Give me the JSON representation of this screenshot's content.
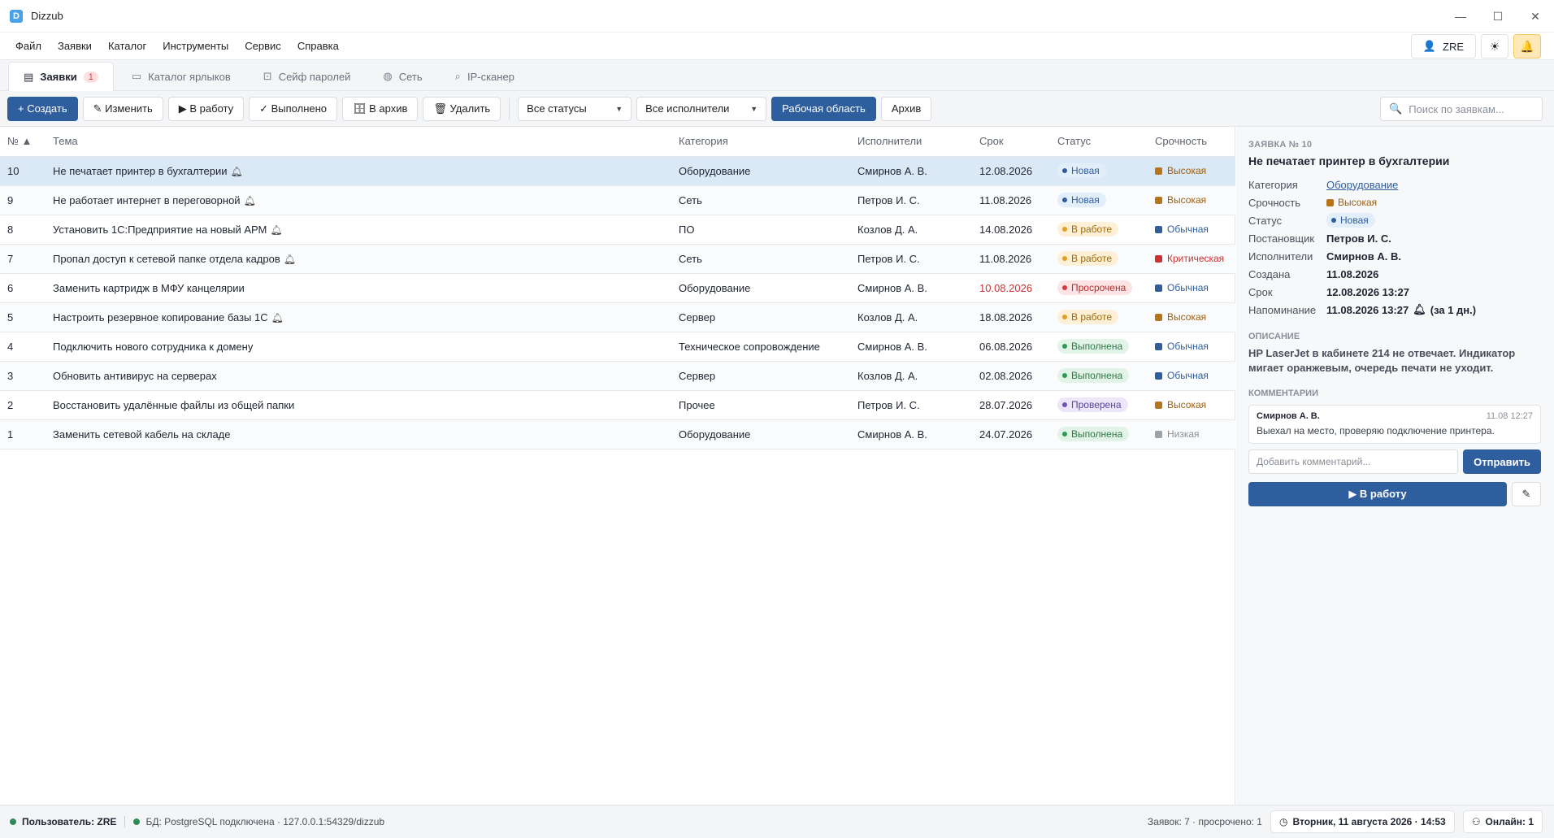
{
  "window": {
    "title": "Dizzub",
    "logo_letter": "D"
  },
  "menubar": {
    "items": [
      "Файл",
      "Заявки",
      "Каталог",
      "Инструменты",
      "Сервис",
      "Справка"
    ],
    "user_label": "ZRE",
    "theme_icon": "sun-icon",
    "notify_icon": "bell-icon"
  },
  "tabs": [
    {
      "label": "Заявки",
      "badge": "1",
      "icon": "clipboard-icon",
      "active": true
    },
    {
      "label": "Каталог ярлыков",
      "icon": "folder-icon",
      "active": false
    },
    {
      "label": "Сейф паролей",
      "icon": "lock-icon",
      "active": false
    },
    {
      "label": "Сеть",
      "icon": "globe-icon",
      "active": false
    },
    {
      "label": "IP-сканер",
      "icon": "magnifier-icon",
      "active": false
    }
  ],
  "toolbar": {
    "create": "+ Создать",
    "edit": "✎ Изменить",
    "to_work": "▶ В работу",
    "done": "✓ Выполнено",
    "archive": "🗄 В архив",
    "delete": "🗑 Удалить",
    "status_filter": "Все статусы",
    "assignee_filter": "Все исполнители",
    "workspace": "Рабочая область",
    "archive_view": "Архив",
    "search_placeholder": "Поиск по заявкам..."
  },
  "table": {
    "headers": [
      "№ ▲",
      "Тема",
      "Категория",
      "Исполнители",
      "Срок",
      "Статус",
      "Срочность"
    ],
    "rows": [
      {
        "num": "10",
        "topic": "Не печатает принтер в бухгалтерии",
        "bell": true,
        "category": "Оборудование",
        "assignee": "Смирнов А. В.",
        "due": "12.08.2026",
        "overdue": false,
        "status": "Новая",
        "status_kind": "new",
        "urgency": "Высокая",
        "urgency_kind": "high"
      },
      {
        "num": "9",
        "topic": "Не работает интернет в переговорной",
        "bell": true,
        "category": "Сеть",
        "assignee": "Петров И. С.",
        "due": "11.08.2026",
        "overdue": false,
        "status": "Новая",
        "status_kind": "new",
        "urgency": "Высокая",
        "urgency_kind": "high"
      },
      {
        "num": "8",
        "topic": "Установить 1С:Предприятие на новый АРМ",
        "bell": true,
        "category": "ПО",
        "assignee": "Козлов Д. А.",
        "due": "14.08.2026",
        "overdue": false,
        "status": "В работе",
        "status_kind": "work",
        "urgency": "Обычная",
        "urgency_kind": "normal"
      },
      {
        "num": "7",
        "topic": "Пропал доступ к сетевой папке отдела кадров",
        "bell": true,
        "category": "Сеть",
        "assignee": "Петров И. С.",
        "due": "11.08.2026",
        "overdue": false,
        "status": "В работе",
        "status_kind": "work",
        "urgency": "Критическая",
        "urgency_kind": "critical"
      },
      {
        "num": "6",
        "topic": "Заменить картридж в МФУ канцелярии",
        "bell": false,
        "category": "Оборудование",
        "assignee": "Смирнов А. В.",
        "due": "10.08.2026",
        "overdue": true,
        "status": "Просрочена",
        "status_kind": "overdue",
        "urgency": "Обычная",
        "urgency_kind": "normal"
      },
      {
        "num": "5",
        "topic": "Настроить резервное копирование базы 1С",
        "bell": true,
        "category": "Сервер",
        "assignee": "Козлов Д. А.",
        "due": "18.08.2026",
        "overdue": false,
        "status": "В работе",
        "status_kind": "work",
        "urgency": "Высокая",
        "urgency_kind": "high"
      },
      {
        "num": "4",
        "topic": "Подключить нового сотрудника к домену",
        "bell": false,
        "category": "Техническое сопровождение",
        "assignee": "Смирнов А. В.",
        "due": "06.08.2026",
        "overdue": false,
        "status": "Выполнена",
        "status_kind": "done",
        "urgency": "Обычная",
        "urgency_kind": "normal"
      },
      {
        "num": "3",
        "topic": "Обновить антивирус на серверах",
        "bell": false,
        "category": "Сервер",
        "assignee": "Козлов Д. А.",
        "due": "02.08.2026",
        "overdue": false,
        "status": "Выполнена",
        "status_kind": "done",
        "urgency": "Обычная",
        "urgency_kind": "normal"
      },
      {
        "num": "2",
        "topic": "Восстановить удалённые файлы из общей папки",
        "bell": false,
        "category": "Прочее",
        "assignee": "Петров И. С.",
        "due": "28.07.2026",
        "overdue": false,
        "status": "Проверена",
        "status_kind": "checked",
        "urgency": "Высокая",
        "urgency_kind": "high"
      },
      {
        "num": "1",
        "topic": "Заменить сетевой кабель на складе",
        "bell": false,
        "category": "Оборудование",
        "assignee": "Смирнов А. В.",
        "due": "24.07.2026",
        "overdue": false,
        "status": "Выполнена",
        "status_kind": "done",
        "urgency": "Низкая",
        "urgency_kind": "low"
      }
    ]
  },
  "status_colors": {
    "new": {
      "bg": "#e3eefb",
      "fg": "#2f5e9e",
      "dot": "#2f5e9e"
    },
    "work": {
      "bg": "#fdf0d6",
      "fg": "#9a6a10",
      "dot": "#e0a020"
    },
    "overdue": {
      "bg": "#fde3e3",
      "fg": "#b33030",
      "dot": "#d63b3b"
    },
    "done": {
      "bg": "#e2f3e7",
      "fg": "#2b7a46",
      "dot": "#2e9a56"
    },
    "checked": {
      "bg": "#ece6f8",
      "fg": "#5a44a0",
      "dot": "#6a52b8"
    }
  },
  "urgency_colors": {
    "high": {
      "sq": "#b8741a",
      "fg": "#9a5e12"
    },
    "normal": {
      "sq": "#2f5e9e",
      "fg": "#2f5e9e"
    },
    "critical": {
      "sq": "#c93333",
      "fg": "#c93333"
    },
    "low": {
      "sq": "#9aa1ab",
      "fg": "#8a9099"
    }
  },
  "selected_row": 0,
  "detail": {
    "kicker": "ЗАЯВКА № 10",
    "title": "Не печатает принтер в бухгалтерии",
    "fields": {
      "category_label": "Категория",
      "category": "Оборудование",
      "urgency_label": "Срочность",
      "urgency": "Высокая",
      "status_label": "Статус",
      "status": "Новая",
      "reporter_label": "Постановщик",
      "reporter": "Петров И. С.",
      "assignees_label": "Исполнители",
      "assignees": "Смирнов А. В.",
      "created_label": "Создана",
      "created": "11.08.2026",
      "due_label": "Срок",
      "due": "12.08.2026 13:27",
      "reminder_label": "Напоминание",
      "reminder": "11.08.2026 13:27",
      "reminder_note": "(за 1 дн.)"
    },
    "description_header": "ОПИСАНИЕ",
    "description": "HP LaserJet в кабинете 214 не отвечает. Индикатор мигает оранжевым, очередь печати не уходит.",
    "comments_header": "КОММЕНТАРИИ",
    "comment": {
      "author": "Смирнов А. В.",
      "time": "11.08 12:27",
      "text": "Выехал на место, проверяю подключение принтера."
    },
    "comment_placeholder": "Добавить комментарий...",
    "send": "Отправить",
    "work_button": "▶ В работу",
    "edit_icon": "pencil-icon"
  },
  "statusbar": {
    "user": "Пользователь: ZRE",
    "db": "БД: PostgreSQL подключена · 127.0.0.1:54329/dizzub",
    "counts": "Заявок: 7 · просрочено: 1",
    "datetime": "Вторник, 11 августа 2026 · 14:53",
    "online": "Онлайн: 1"
  }
}
